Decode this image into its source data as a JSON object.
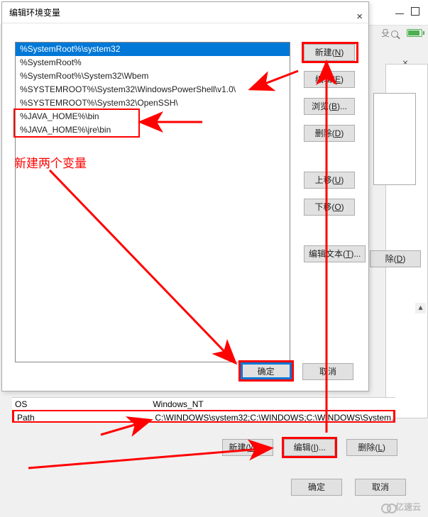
{
  "dialog": {
    "title": "编辑环境变量",
    "close_glyph": "×",
    "list_items": [
      "%SystemRoot%\\system32",
      "%SystemRoot%",
      "%SystemRoot%\\System32\\Wbem",
      "%SYSTEMROOT%\\System32\\WindowsPowerShell\\v1.0\\",
      "%SYSTEMROOT%\\System32\\OpenSSH\\",
      "%JAVA_HOME%\\bin",
      "%JAVA_HOME%\\jre\\bin"
    ],
    "selected_index": 0,
    "buttons": {
      "new": {
        "label": "新建",
        "hotkey": "N"
      },
      "edit": {
        "label": "编辑",
        "hotkey": "E"
      },
      "browse": {
        "label": "浏览",
        "hotkey": "B",
        "suffix": "..."
      },
      "delete": {
        "label": "删除",
        "hotkey": "D"
      },
      "move_up": {
        "label": "上移",
        "hotkey": "U"
      },
      "move_down": {
        "label": "下移",
        "hotkey": "O"
      },
      "edit_text": {
        "label": "编辑文本",
        "hotkey": "T",
        "suffix": "..."
      }
    },
    "ok": "确定",
    "cancel": "取消"
  },
  "mid": {
    "rows": {
      "os": {
        "name": "OS",
        "value": "Windows_NT"
      },
      "path": {
        "name": "Path",
        "value": "C:\\WINDOWS\\system32;C:\\WINDOWS;C:\\WINDOWS\\System..."
      }
    },
    "buttons": {
      "new": {
        "label": "新建",
        "hotkey": "W",
        "suffix": "..."
      },
      "edit": {
        "label": "编辑",
        "hotkey": "I",
        "suffix": "..."
      },
      "delete": {
        "label": "删除",
        "hotkey": "L"
      }
    }
  },
  "parent": {
    "delete_btn": {
      "label": "除",
      "hotkey": "D"
    },
    "ok": "确定",
    "cancel": "取消",
    "search_fragment": "殳",
    "close_glyph": "×",
    "scroll_up_glyph": "▴"
  },
  "annotation": {
    "text": "新建两个变量"
  },
  "watermark": "亿速云",
  "colors": {
    "highlight": "#ff0000",
    "selection": "#0078d7"
  }
}
